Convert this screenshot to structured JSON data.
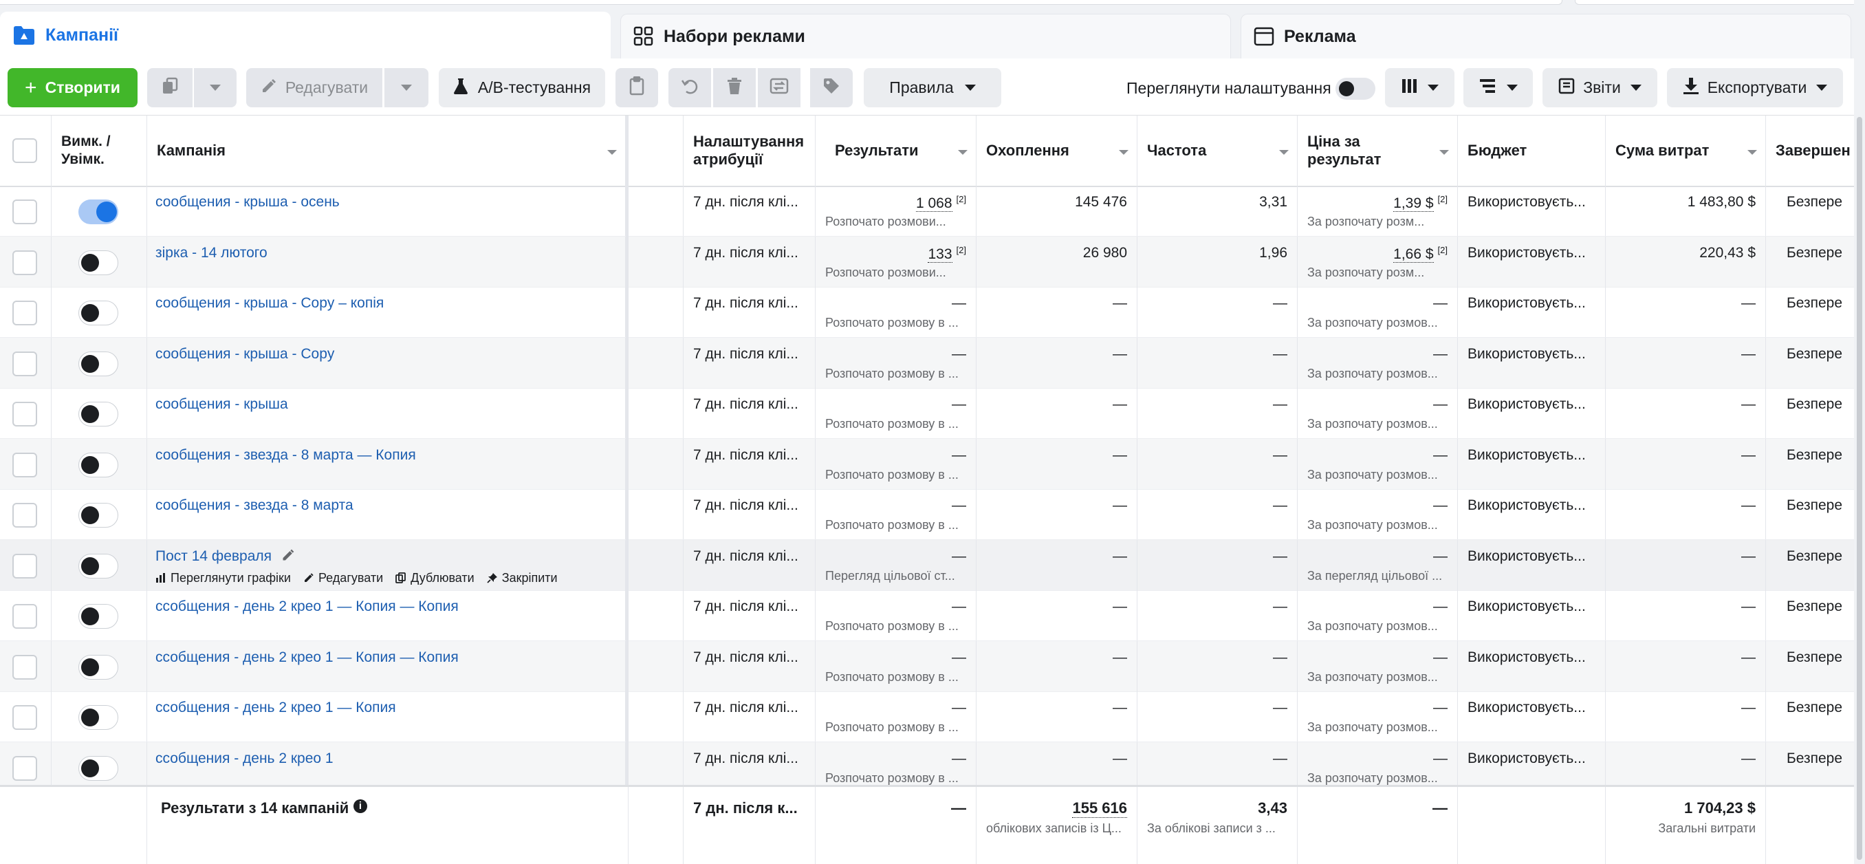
{
  "tabs": [
    {
      "label": "Кампанії",
      "icon": "folder-icon",
      "active": true
    },
    {
      "label": "Набори реклами",
      "icon": "grid-icon",
      "active": false
    },
    {
      "label": "Реклама",
      "icon": "ad-window-icon",
      "active": false
    }
  ],
  "toolbar": {
    "create": "Створити",
    "edit": "Редагувати",
    "ab_test": "A/B-тестування",
    "rules": "Правила",
    "view_settings": "Переглянути налаштування",
    "reports": "Звіти",
    "export": "Експортувати"
  },
  "columns": {
    "toggle": "Вимк. / Увімк.",
    "campaign": "Кампанія",
    "attribution": "Налаштування атрибуції",
    "results": "Результати",
    "reach": "Охоплення",
    "frequency": "Частота",
    "cost_per_result": "Ціна за результат",
    "budget": "Бюджет",
    "amount_spent": "Сума витрат",
    "ends": "Завершен"
  },
  "rows": [
    {
      "name": "сообщения - крыша - осень",
      "on": true,
      "attribution": "7 дн. після клі...",
      "results": "1 068",
      "results_ref": "[2]",
      "results_sub": "Розпочато розмови...",
      "reach": "145 476",
      "frequency": "3,31",
      "cost": "1,39 $",
      "cost_ref": "[2]",
      "cost_sub": "За розпочату розм...",
      "budget": "Використовуєть...",
      "spent": "1 483,80 $",
      "ends": "Безпере"
    },
    {
      "name": "зірка - 14 лютого",
      "on": false,
      "attribution": "7 дн. після клі...",
      "results": "133",
      "results_ref": "[2]",
      "results_sub": "Розпочато розмови...",
      "reach": "26 980",
      "frequency": "1,96",
      "cost": "1,66 $",
      "cost_ref": "[2]",
      "cost_sub": "За розпочату розм...",
      "budget": "Використовуєть...",
      "spent": "220,43 $",
      "ends": "Безпере"
    },
    {
      "name": "сообщения - крыша - Copy – копія",
      "on": false,
      "attribution": "7 дн. після клі...",
      "results": "—",
      "results_ref": "",
      "results_sub": "Розпочато розмову в ...",
      "reach": "—",
      "frequency": "—",
      "cost": "—",
      "cost_ref": "",
      "cost_sub": "За розпочату розмов...",
      "budget": "Використовуєть...",
      "spent": "—",
      "ends": "Безпере"
    },
    {
      "name": "сообщения - крыша - Copy",
      "on": false,
      "attribution": "7 дн. після клі...",
      "results": "—",
      "results_ref": "",
      "results_sub": "Розпочато розмову в ...",
      "reach": "—",
      "frequency": "—",
      "cost": "—",
      "cost_ref": "",
      "cost_sub": "За розпочату розмов...",
      "budget": "Використовуєть...",
      "spent": "—",
      "ends": "Безпере"
    },
    {
      "name": "сообщения - крыша",
      "on": false,
      "attribution": "7 дн. після клі...",
      "results": "—",
      "results_ref": "",
      "results_sub": "Розпочато розмову в ...",
      "reach": "—",
      "frequency": "—",
      "cost": "—",
      "cost_ref": "",
      "cost_sub": "За розпочату розмов...",
      "budget": "Використовуєть...",
      "spent": "—",
      "ends": "Безпере"
    },
    {
      "name": "сообщения - звезда - 8 марта — Копия",
      "on": false,
      "attribution": "7 дн. після клі...",
      "results": "—",
      "results_ref": "",
      "results_sub": "Розпочато розмову в ...",
      "reach": "—",
      "frequency": "—",
      "cost": "—",
      "cost_ref": "",
      "cost_sub": "За розпочату розмов...",
      "budget": "Використовуєть...",
      "spent": "—",
      "ends": "Безпере"
    },
    {
      "name": "сообщения - звезда - 8 марта",
      "on": false,
      "attribution": "7 дн. після клі...",
      "results": "—",
      "results_ref": "",
      "results_sub": "Розпочато розмову в ...",
      "reach": "—",
      "frequency": "—",
      "cost": "—",
      "cost_ref": "",
      "cost_sub": "За розпочату розмов...",
      "budget": "Використовуєть...",
      "spent": "—",
      "ends": "Безпере"
    },
    {
      "name": "Пост 14 февраля",
      "on": false,
      "attribution": "7 дн. після клі...",
      "results": "—",
      "results_ref": "",
      "results_sub": "Перегляд цільової ст...",
      "reach": "—",
      "frequency": "—",
      "cost": "—",
      "cost_ref": "",
      "cost_sub": "За перегляд цільової ...",
      "budget": "Використовуєть...",
      "spent": "—",
      "ends": "Безпере"
    },
    {
      "name": "ссобщения - день 2 крео 1 — Копия — Копия",
      "on": false,
      "attribution": "7 дн. після клі...",
      "results": "—",
      "results_ref": "",
      "results_sub": "Розпочато розмову в ...",
      "reach": "—",
      "frequency": "—",
      "cost": "—",
      "cost_ref": "",
      "cost_sub": "За розпочату розмов...",
      "budget": "Використовуєть...",
      "spent": "—",
      "ends": "Безпере"
    },
    {
      "name": "ссобщения - день 2 крео 1 — Копия — Копия",
      "on": false,
      "attribution": "7 дн. після клі...",
      "results": "—",
      "results_ref": "",
      "results_sub": "Розпочато розмову в ...",
      "reach": "—",
      "frequency": "—",
      "cost": "—",
      "cost_ref": "",
      "cost_sub": "За розпочату розмов...",
      "budget": "Використовуєть...",
      "spent": "—",
      "ends": "Безпере"
    },
    {
      "name": "ссобщения - день 2 крео 1 — Копия",
      "on": false,
      "attribution": "7 дн. після клі...",
      "results": "—",
      "results_ref": "",
      "results_sub": "Розпочато розмову в ...",
      "reach": "—",
      "frequency": "—",
      "cost": "—",
      "cost_ref": "",
      "cost_sub": "За розпочату розмов...",
      "budget": "Використовуєть...",
      "spent": "—",
      "ends": "Безпере"
    },
    {
      "name": "ссобщения - день 2 крео 1",
      "on": false,
      "attribution": "7 дн. після клі...",
      "results": "—",
      "results_ref": "",
      "results_sub": "Розпочато розмову в ...",
      "reach": "—",
      "frequency": "—",
      "cost": "—",
      "cost_ref": "",
      "cost_sub": "За розпочату розмов...",
      "budget": "Використовуєть...",
      "spent": "—",
      "ends": "Безпере"
    }
  ],
  "row_actions": {
    "view_charts": "Переглянути графіки",
    "edit": "Редагувати",
    "duplicate": "Дублювати",
    "pin": "Закріпити"
  },
  "footer": {
    "label": "Результати з 14 кампаній",
    "attribution": "7 дн. після к...",
    "results": "—",
    "reach": "155 616",
    "reach_sub": "облікових записів із Ц...",
    "frequency": "3,43",
    "frequency_sub": "За облікові записи з ...",
    "cost": "—",
    "spent": "1 704,23 $",
    "spent_sub": "Загальні витрати"
  },
  "colors": {
    "accent": "#1b74e4",
    "create": "#42b72a",
    "link": "#1d5eb0"
  }
}
